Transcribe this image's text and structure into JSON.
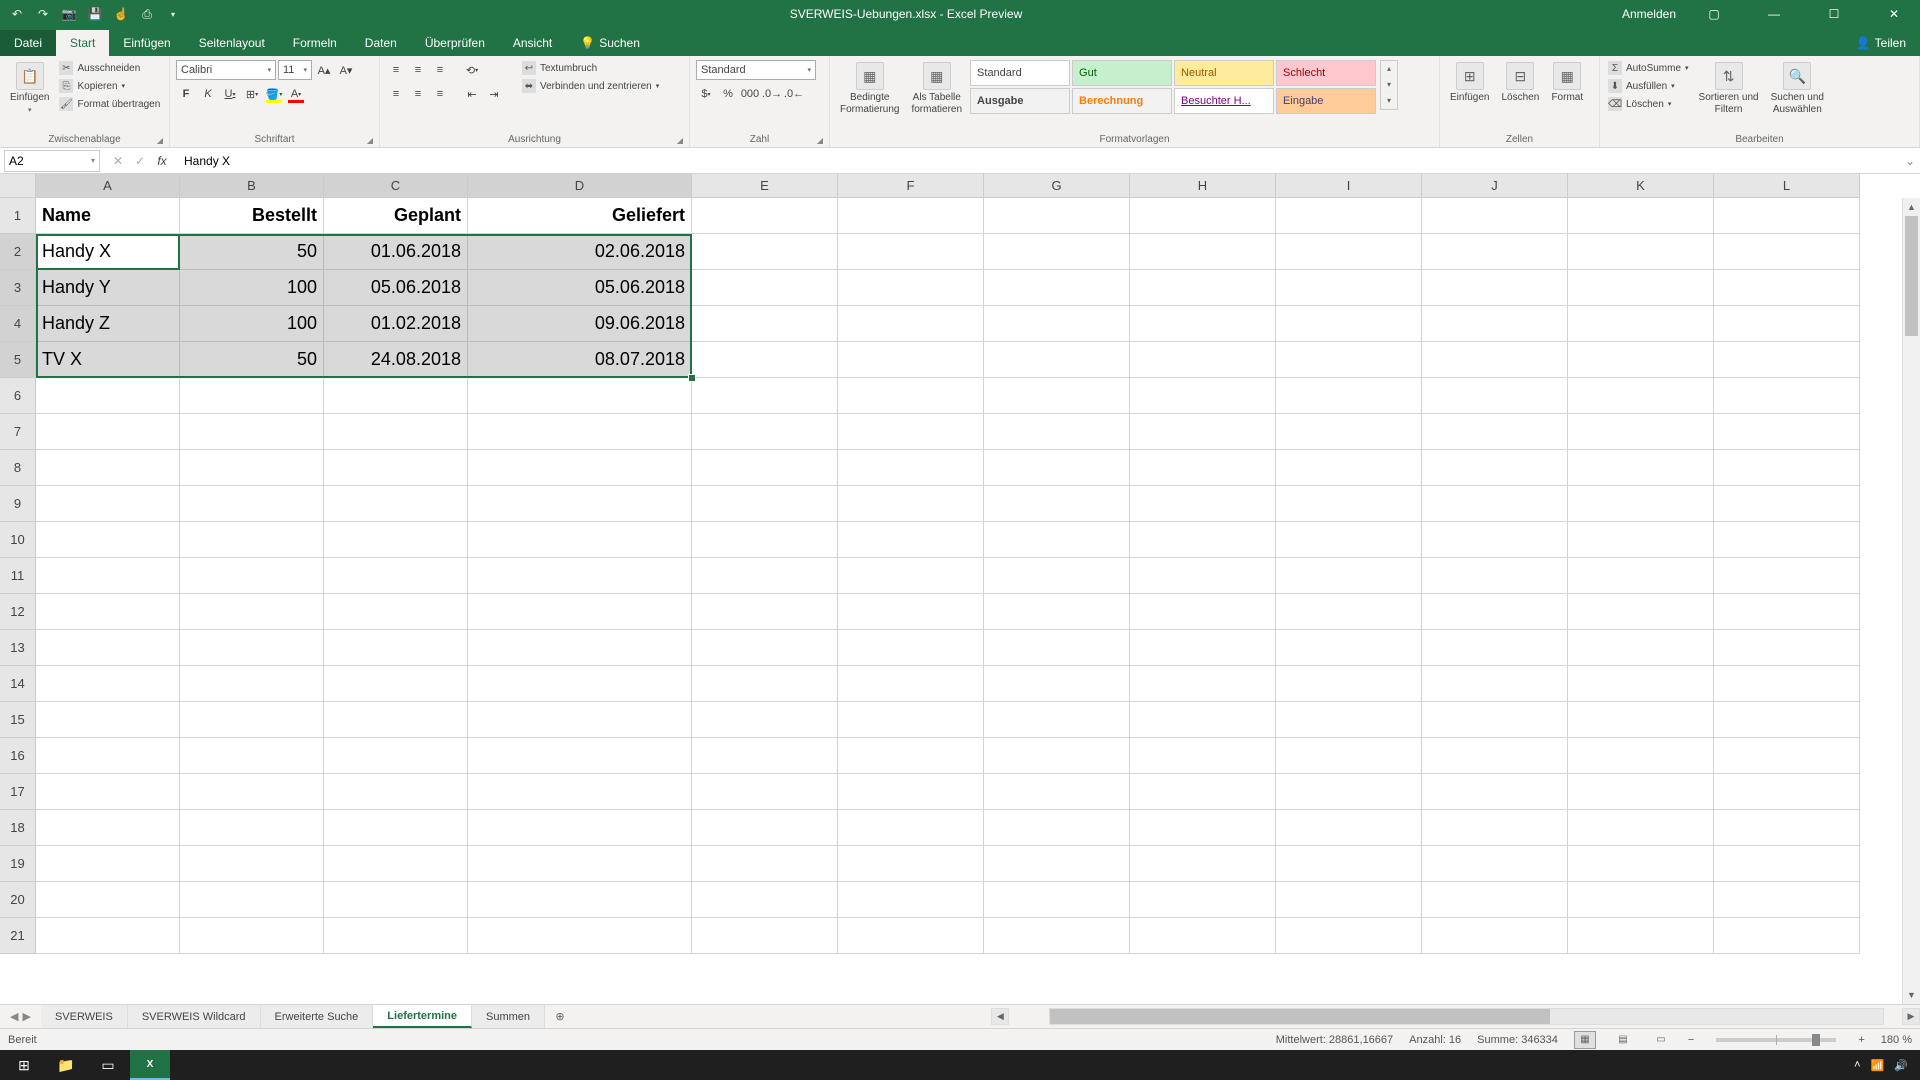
{
  "title": "SVERWEIS-Uebungen.xlsx - Excel Preview",
  "account": "Anmelden",
  "share": "Teilen",
  "tabs": {
    "datei": "Datei",
    "start": "Start",
    "einfuegen": "Einfügen",
    "seitenlayout": "Seitenlayout",
    "formeln": "Formeln",
    "daten": "Daten",
    "ueberpruefen": "Überprüfen",
    "ansicht": "Ansicht",
    "suchen": "Suchen"
  },
  "ribbon": {
    "zwischenablage": {
      "label": "Zwischenablage",
      "einfuegen": "Einfügen",
      "ausschneiden": "Ausschneiden",
      "kopieren": "Kopieren",
      "format": "Format übertragen"
    },
    "schriftart": {
      "label": "Schriftart",
      "font": "Calibri",
      "size": "11"
    },
    "ausrichtung": {
      "label": "Ausrichtung",
      "textumbruch": "Textumbruch",
      "verbinden": "Verbinden und zentrieren"
    },
    "zahl": {
      "label": "Zahl",
      "format": "Standard"
    },
    "formatvorlagen": {
      "label": "Formatvorlagen",
      "bedingte": "Bedingte\nFormatierung",
      "alstabelle": "Als Tabelle\nformatieren",
      "styles": {
        "standard": "Standard",
        "gut": "Gut",
        "neutral": "Neutral",
        "schlecht": "Schlecht",
        "ausgabe": "Ausgabe",
        "berechnung": "Berechnung",
        "besucht": "Besuchter H...",
        "eingabe": "Eingabe"
      }
    },
    "zellen": {
      "label": "Zellen",
      "einfuegen": "Einfügen",
      "loeschen": "Löschen",
      "format": "Format"
    },
    "bearbeiten": {
      "label": "Bearbeiten",
      "autosumme": "AutoSumme",
      "ausfuellen": "Ausfüllen",
      "loeschen": "Löschen",
      "sortieren": "Sortieren und\nFiltern",
      "suchen": "Suchen und\nAuswählen"
    }
  },
  "namebox": "A2",
  "formula": "Handy X",
  "columns": [
    "A",
    "B",
    "C",
    "D",
    "E",
    "F",
    "G",
    "H",
    "I",
    "J",
    "K",
    "L"
  ],
  "rows": [
    "1",
    "2",
    "3",
    "4",
    "5",
    "6",
    "7",
    "8",
    "9",
    "10",
    "11",
    "12",
    "13",
    "14",
    "15",
    "16",
    "17",
    "18",
    "19",
    "20",
    "21"
  ],
  "chart_data": {
    "type": "table",
    "headers": [
      "Name",
      "Bestellt",
      "Geplant",
      "Geliefert"
    ],
    "data": [
      [
        "Handy X",
        "50",
        "01.06.2018",
        "02.06.2018"
      ],
      [
        "Handy Y",
        "100",
        "05.06.2018",
        "05.06.2018"
      ],
      [
        "Handy Z",
        "100",
        "01.02.2018",
        "09.06.2018"
      ],
      [
        "TV X",
        "50",
        "24.08.2018",
        "08.07.2018"
      ]
    ]
  },
  "sheets": [
    "SVERWEIS",
    "SVERWEIS Wildcard",
    "Erweiterte Suche",
    "Liefertermine",
    "Summen"
  ],
  "active_sheet": 3,
  "status": {
    "ready": "Bereit",
    "avg_label": "Mittelwert:",
    "avg": "28861,16667",
    "count_label": "Anzahl:",
    "count": "16",
    "sum_label": "Summe:",
    "sum": "346334",
    "zoom": "180 %"
  }
}
